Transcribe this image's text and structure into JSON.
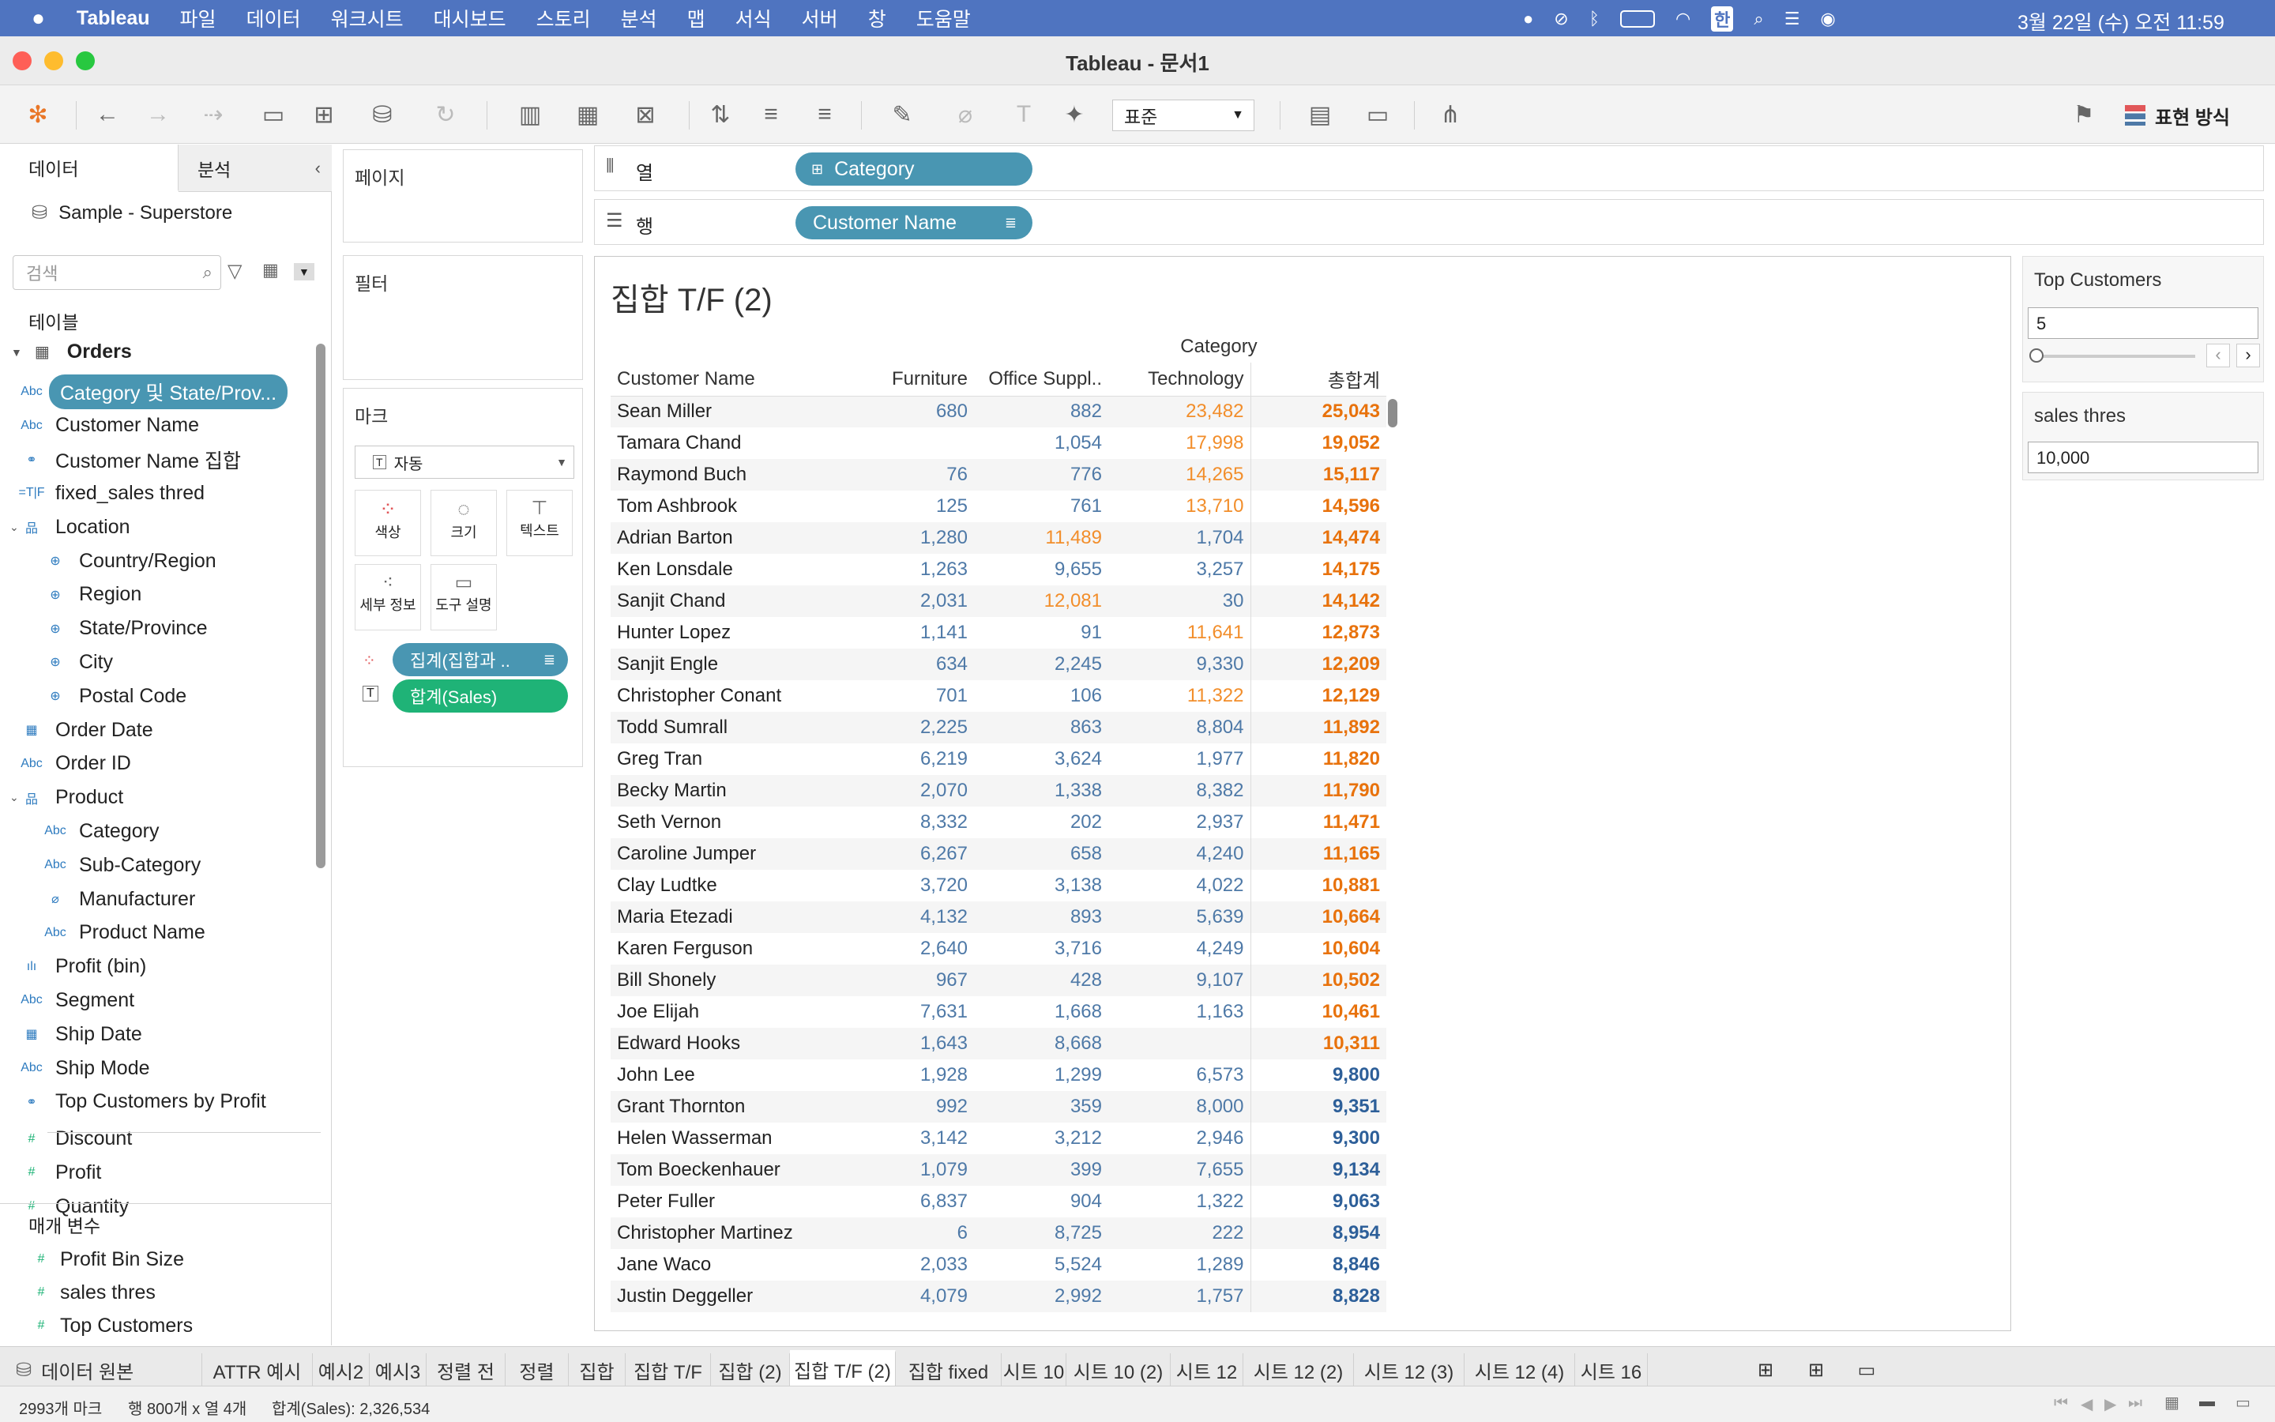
{
  "menubar": {
    "app": "Tableau",
    "items": [
      "파일",
      "데이터",
      "워크시트",
      "대시보드",
      "스토리",
      "분석",
      "맵",
      "서식",
      "서버",
      "창",
      "도움말"
    ],
    "clock": "3월 22일 (수) 오전  11:59",
    "input_indicator": "한"
  },
  "window": {
    "title": "Tableau - 문서1"
  },
  "toolbar": {
    "fit_select": "표준",
    "show_me": "표현 방식"
  },
  "datapane": {
    "tab_data": "데이터",
    "tab_analysis": "분석",
    "datasource": "Sample - Superstore",
    "search_placeholder": "검색",
    "tables_title": "테이블",
    "table_name": "Orders",
    "fields": [
      {
        "label": "Category 및 State/Prov...",
        "icon": "Abc",
        "selected": true
      },
      {
        "label": "Customer Name",
        "icon": "Abc"
      },
      {
        "label": "Customer Name 집합",
        "icon": "set"
      },
      {
        "label": "fixed_sales thred",
        "icon": "=T|F"
      },
      {
        "label": "Location",
        "icon": "hier"
      },
      {
        "label": "Country/Region",
        "icon": "globe"
      },
      {
        "label": "Region",
        "icon": "globe"
      },
      {
        "label": "State/Province",
        "icon": "globe"
      },
      {
        "label": "City",
        "icon": "globe"
      },
      {
        "label": "Postal Code",
        "icon": "globe"
      },
      {
        "label": "Order Date",
        "icon": "date"
      },
      {
        "label": "Order ID",
        "icon": "Abc"
      },
      {
        "label": "Product",
        "icon": "hier"
      },
      {
        "label": "Category",
        "icon": "Abc"
      },
      {
        "label": "Sub-Category",
        "icon": "Abc"
      },
      {
        "label": "Manufacturer",
        "icon": "clip"
      },
      {
        "label": "Product Name",
        "icon": "Abc"
      },
      {
        "label": "Profit (bin)",
        "icon": "bin"
      },
      {
        "label": "Segment",
        "icon": "Abc"
      },
      {
        "label": "Ship Date",
        "icon": "date"
      },
      {
        "label": "Ship Mode",
        "icon": "Abc"
      },
      {
        "label": "Top Customers by Profit",
        "icon": "set"
      },
      {
        "label": "Discount",
        "icon": "#"
      },
      {
        "label": "Profit",
        "icon": "#"
      },
      {
        "label": "Quantity",
        "icon": "#"
      }
    ],
    "params_title": "매개 변수",
    "params": [
      "Profit Bin Size",
      "sales thres",
      "Top Customers"
    ]
  },
  "cards": {
    "pages": "페이지",
    "filters": "필터",
    "marks": "마크",
    "mark_type": "자동",
    "color": "색상",
    "size": "크기",
    "text": "텍스트",
    "detail": "세부 정보",
    "tooltip": "도구 설명",
    "pill1": "집계(집합과 ..",
    "pill2": "합계(Sales)"
  },
  "shelves": {
    "columns_label": "열",
    "rows_label": "행",
    "columns_pill": "Category",
    "rows_pill": "Customer Name"
  },
  "view": {
    "title": "집합 T/F (2)",
    "col_group": "Category",
    "headers": [
      "Customer Name",
      "Furniture",
      "Office Suppl..",
      "Technology",
      "총합계"
    ],
    "rows": [
      [
        "Sean Miller",
        "680",
        "882",
        "23,482",
        "25,043"
      ],
      [
        "Tamara Chand",
        "",
        "1,054",
        "17,998",
        "19,052"
      ],
      [
        "Raymond Buch",
        "76",
        "776",
        "14,265",
        "15,117"
      ],
      [
        "Tom Ashbrook",
        "125",
        "761",
        "13,710",
        "14,596"
      ],
      [
        "Adrian Barton",
        "1,280",
        "11,489",
        "1,704",
        "14,474"
      ],
      [
        "Ken Lonsdale",
        "1,263",
        "9,655",
        "3,257",
        "14,175"
      ],
      [
        "Sanjit Chand",
        "2,031",
        "12,081",
        "30",
        "14,142"
      ],
      [
        "Hunter Lopez",
        "1,141",
        "91",
        "11,641",
        "12,873"
      ],
      [
        "Sanjit Engle",
        "634",
        "2,245",
        "9,330",
        "12,209"
      ],
      [
        "Christopher Conant",
        "701",
        "106",
        "11,322",
        "12,129"
      ],
      [
        "Todd Sumrall",
        "2,225",
        "863",
        "8,804",
        "11,892"
      ],
      [
        "Greg Tran",
        "6,219",
        "3,624",
        "1,977",
        "11,820"
      ],
      [
        "Becky Martin",
        "2,070",
        "1,338",
        "8,382",
        "11,790"
      ],
      [
        "Seth Vernon",
        "8,332",
        "202",
        "2,937",
        "11,471"
      ],
      [
        "Caroline Jumper",
        "6,267",
        "658",
        "4,240",
        "11,165"
      ],
      [
        "Clay Ludtke",
        "3,720",
        "3,138",
        "4,022",
        "10,881"
      ],
      [
        "Maria Etezadi",
        "4,132",
        "893",
        "5,639",
        "10,664"
      ],
      [
        "Karen Ferguson",
        "2,640",
        "3,716",
        "4,249",
        "10,604"
      ],
      [
        "Bill Shonely",
        "967",
        "428",
        "9,107",
        "10,502"
      ],
      [
        "Joe Elijah",
        "7,631",
        "1,668",
        "1,163",
        "10,461"
      ],
      [
        "Edward Hooks",
        "1,643",
        "8,668",
        "",
        "10,311"
      ],
      [
        "John Lee",
        "1,928",
        "1,299",
        "6,573",
        "9,800"
      ],
      [
        "Grant Thornton",
        "992",
        "359",
        "8,000",
        "9,351"
      ],
      [
        "Helen Wasserman",
        "3,142",
        "3,212",
        "2,946",
        "9,300"
      ],
      [
        "Tom Boeckenhauer",
        "1,079",
        "399",
        "7,655",
        "9,134"
      ],
      [
        "Peter Fuller",
        "6,837",
        "904",
        "1,322",
        "9,063"
      ],
      [
        "Christopher Martinez",
        "6",
        "8,725",
        "222",
        "8,954"
      ],
      [
        "Jane Waco",
        "2,033",
        "5,524",
        "1,289",
        "8,846"
      ],
      [
        "Justin Deggeller",
        "4,079",
        "2,992",
        "1,757",
        "8,828"
      ]
    ],
    "threshold": 10000,
    "colors": {
      "above": "#f28e2b",
      "below": "#4e79a7",
      "above_total": "#e8720c",
      "below_total": "#2d5f99"
    }
  },
  "params_panel": {
    "top_customers_title": "Top Customers",
    "top_customers_value": "5",
    "sales_thres_title": "sales thres",
    "sales_thres_value": "10,000"
  },
  "tabs": {
    "datasource": "데이터 원본",
    "sheets": [
      "ATTR 예시",
      "예시2",
      "예시3",
      "정렬 전",
      "정렬",
      "집합",
      "집합 T/F",
      "집합 (2)",
      "집합 T/F (2)",
      "집합 fixed",
      "시트 10",
      "시트 10 (2)",
      "시트 12",
      "시트 12 (2)",
      "시트 12 (3)",
      "시트 12 (4)",
      "시트 16"
    ],
    "active": "집합 T/F (2)"
  },
  "status": {
    "marks": "2993개 마크",
    "rowcol": "행 800개 x 열 4개",
    "sum": "합계(Sales): 2,326,534"
  }
}
